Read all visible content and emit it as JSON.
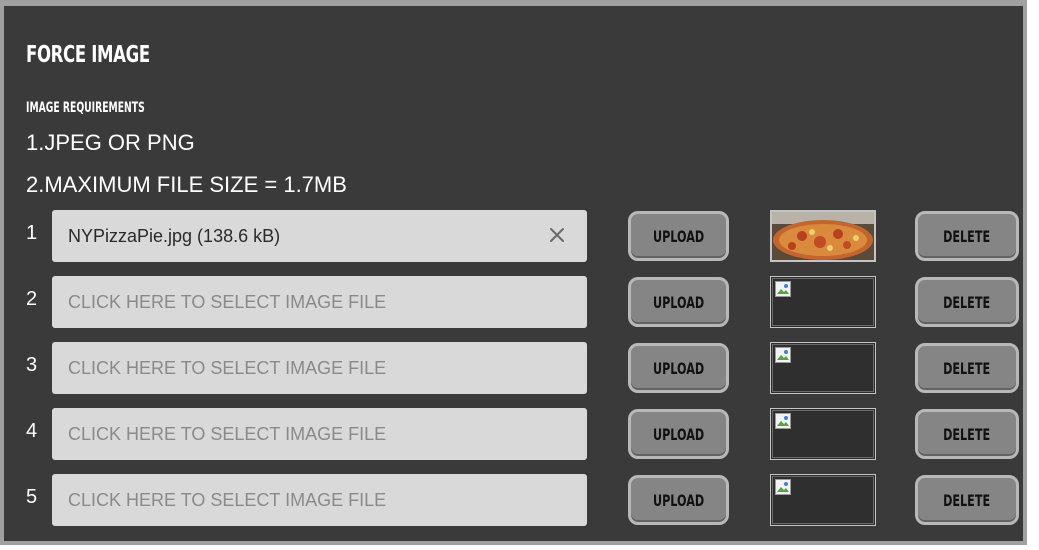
{
  "header": {
    "title": "FORCE IMAGE",
    "requirements_title": "IMAGE REQUIREMENTS",
    "requirement_1": "1.JPEG OR PNG",
    "requirement_2": "2.MAXIMUM FILE SIZE = 1.7MB"
  },
  "rows": [
    {
      "number": "1",
      "file_value": "NYPizzaPie.jpg (138.6 kB)",
      "upload_label": "UPLOAD",
      "delete_label": "DELETE",
      "thumbnail": "pizza-image"
    },
    {
      "number": "2",
      "file_placeholder": "CLICK HERE TO SELECT IMAGE FILE",
      "upload_label": "UPLOAD",
      "delete_label": "DELETE",
      "thumbnail": "broken-image-icon"
    },
    {
      "number": "3",
      "file_placeholder": "CLICK HERE TO SELECT IMAGE FILE",
      "upload_label": "UPLOAD",
      "delete_label": "DELETE",
      "thumbnail": "broken-image-icon"
    },
    {
      "number": "4",
      "file_placeholder": "CLICK HERE TO SELECT IMAGE FILE",
      "upload_label": "UPLOAD",
      "delete_label": "DELETE",
      "thumbnail": "broken-image-icon"
    },
    {
      "number": "5",
      "file_placeholder": "CLICK HERE TO SELECT IMAGE FILE",
      "upload_label": "UPLOAD",
      "delete_label": "DELETE",
      "thumbnail": "broken-image-icon"
    }
  ],
  "icons": {
    "clear": "close-icon"
  },
  "colors": {
    "panel_background": "#3a3a3a",
    "panel_border": "#a0a0a0",
    "input_background": "#d9d9d9",
    "button_background": "#858585"
  }
}
